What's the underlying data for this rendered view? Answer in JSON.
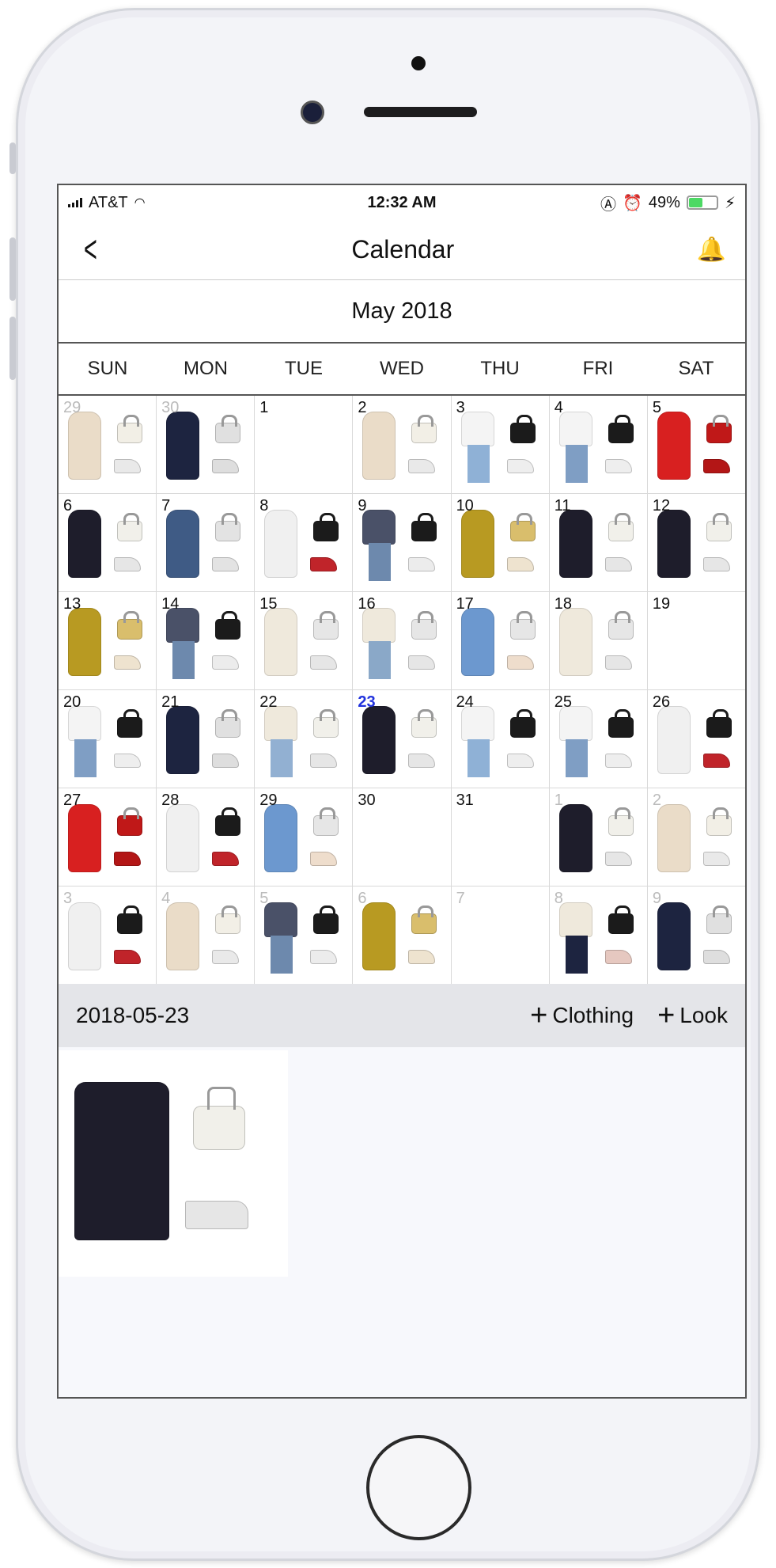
{
  "status_bar": {
    "carrier": "AT&T",
    "time": "12:32 AM",
    "battery_percent": "49%",
    "battery_level": 0.49
  },
  "nav": {
    "title": "Calendar",
    "back_icon": "chevron-left-icon",
    "bell_icon": "bell-icon"
  },
  "calendar": {
    "month_label": "May 2018",
    "weekdays": [
      "SUN",
      "MON",
      "TUE",
      "WED",
      "THU",
      "FRI",
      "SAT"
    ],
    "days": [
      {
        "num": "29",
        "other": true,
        "outfit": "cream"
      },
      {
        "num": "30",
        "other": true,
        "outfit": "navy-jumpsuit"
      },
      {
        "num": "1",
        "outfit": null
      },
      {
        "num": "2",
        "outfit": "cream"
      },
      {
        "num": "3",
        "outfit": "white-denim"
      },
      {
        "num": "4",
        "outfit": "white-jeans"
      },
      {
        "num": "5",
        "outfit": "red"
      },
      {
        "num": "6",
        "outfit": "black-lace"
      },
      {
        "num": "7",
        "outfit": "denim-dress"
      },
      {
        "num": "8",
        "outfit": "white-floral-red"
      },
      {
        "num": "9",
        "outfit": "stripe-jeans"
      },
      {
        "num": "10",
        "outfit": "yellow-dress"
      },
      {
        "num": "11",
        "outfit": "black-lace"
      },
      {
        "num": "12",
        "outfit": "black-lace"
      },
      {
        "num": "13",
        "outfit": "yellow-dress"
      },
      {
        "num": "14",
        "outfit": "stripe-jeans"
      },
      {
        "num": "15",
        "outfit": "ivory"
      },
      {
        "num": "16",
        "outfit": "ivory-jeans"
      },
      {
        "num": "17",
        "outfit": "blue-floral"
      },
      {
        "num": "18",
        "outfit": "ivory"
      },
      {
        "num": "19",
        "outfit": null
      },
      {
        "num": "20",
        "outfit": "white-jeans"
      },
      {
        "num": "21",
        "outfit": "navy-jumpsuit"
      },
      {
        "num": "22",
        "outfit": "ivory-denim"
      },
      {
        "num": "23",
        "today": true,
        "outfit": "black-lace"
      },
      {
        "num": "24",
        "outfit": "white-denim"
      },
      {
        "num": "25",
        "outfit": "white-jeans"
      },
      {
        "num": "26",
        "outfit": "white-floral-red"
      },
      {
        "num": "27",
        "outfit": "red"
      },
      {
        "num": "28",
        "outfit": "white-floral-red"
      },
      {
        "num": "29",
        "outfit": "blue-floral"
      },
      {
        "num": "30",
        "outfit": null
      },
      {
        "num": "31",
        "outfit": null
      },
      {
        "num": "1",
        "other": true,
        "outfit": "black-lace"
      },
      {
        "num": "2",
        "other": true,
        "outfit": "cream"
      },
      {
        "num": "3",
        "other": true,
        "outfit": "white-floral-red"
      },
      {
        "num": "4",
        "other": true,
        "outfit": "cream"
      },
      {
        "num": "5",
        "other": true,
        "outfit": "stripe-jeans"
      },
      {
        "num": "6",
        "other": true,
        "outfit": "yellow-dress"
      },
      {
        "num": "7",
        "other": true,
        "outfit": null
      },
      {
        "num": "8",
        "other": true,
        "outfit": "ivory-navy"
      },
      {
        "num": "9",
        "other": true,
        "outfit": "navy-jumpsuit"
      }
    ]
  },
  "selected": {
    "date": "2018-05-23",
    "add_clothing_label": "Clothing",
    "add_look_label": "Look",
    "looks": [
      {
        "outfit": "black-lace"
      }
    ]
  },
  "outfit_styles": {
    "cream": {
      "garment": "#eadcc8",
      "bag": "#f2efe6",
      "shoe": "#e9e9e9",
      "type": "dress"
    },
    "navy-jumpsuit": {
      "garment": "#1d2440",
      "bag": "#e0e0e0",
      "shoe": "#dedede",
      "type": "dress"
    },
    "white-denim": {
      "garment": "#f4f4f4",
      "pants": "#8fb1d6",
      "bag": "#1b1b1b",
      "shoe": "#eeeeee",
      "type": "top"
    },
    "white-jeans": {
      "garment": "#f4f4f4",
      "pants": "#7f9ec4",
      "bag": "#1b1b1b",
      "shoe": "#eeeeee",
      "type": "top"
    },
    "red": {
      "garment": "#d82020",
      "bag": "#c01818",
      "shoe": "#b31616",
      "type": "dress"
    },
    "black-lace": {
      "garment": "#1e1d2b",
      "bag": "#f1f0ea",
      "shoe": "#e6e6e6",
      "type": "dress"
    },
    "denim-dress": {
      "garment": "#3f5b85",
      "bag": "#e3e3e3",
      "shoe": "#e3e3e3",
      "type": "dress"
    },
    "white-floral-red": {
      "garment": "#f0f0f0",
      "bag": "#1b1b1b",
      "shoe": "#c0242a",
      "type": "dress"
    },
    "stripe-jeans": {
      "garment": "#4a5168",
      "pants": "#6d89ad",
      "bag": "#1b1b1b",
      "shoe": "#ececec",
      "type": "top"
    },
    "yellow-dress": {
      "garment": "#b89a22",
      "bag": "#d9be6c",
      "shoe": "#eee3cf",
      "type": "dress"
    },
    "ivory": {
      "garment": "#efe9dc",
      "bag": "#e6e6e6",
      "shoe": "#e6e6e6",
      "type": "dress"
    },
    "ivory-jeans": {
      "garment": "#efe9dc",
      "pants": "#8aa8c8",
      "bag": "#e6e6e6",
      "shoe": "#e6e6e6",
      "type": "top"
    },
    "blue-floral": {
      "garment": "#6c98cf",
      "bag": "#e6e6e6",
      "shoe": "#eeddcc",
      "type": "dress"
    },
    "ivory-denim": {
      "garment": "#efe9dc",
      "pants": "#92b0d2",
      "bag": "#f1f0ea",
      "shoe": "#e6e6e6",
      "type": "top"
    },
    "ivory-navy": {
      "garment": "#efe9dc",
      "pants": "#1d2440",
      "bag": "#1b1b1b",
      "shoe": "#e6c8c0",
      "type": "top"
    }
  }
}
